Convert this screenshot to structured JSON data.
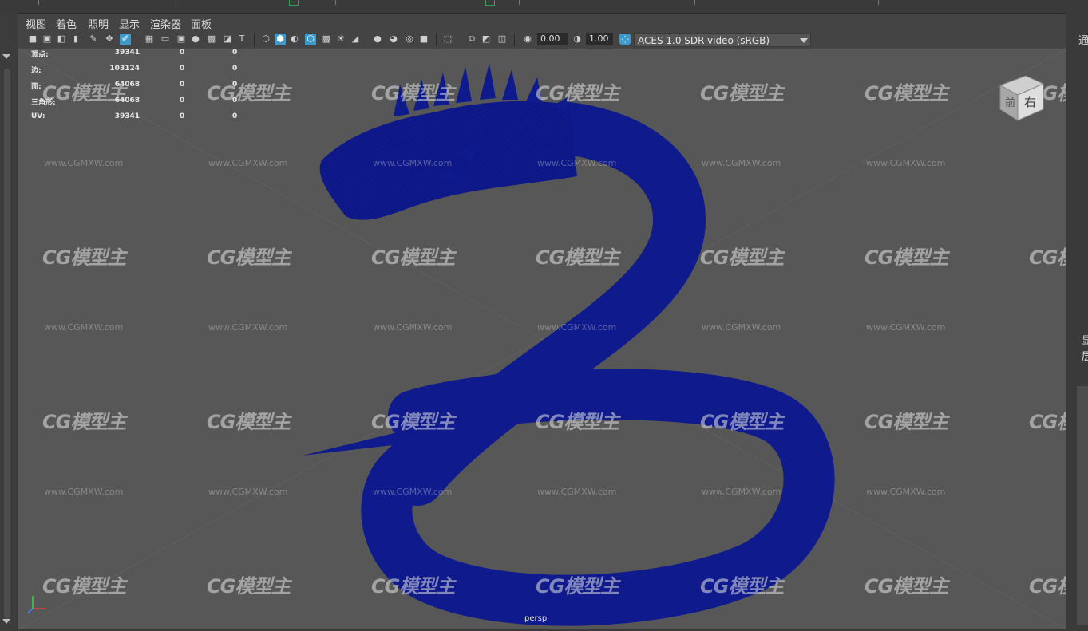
{
  "panel_menu": [
    "视图",
    "着色",
    "照明",
    "显示",
    "渲染器",
    "面板"
  ],
  "toolbar": {
    "exposure_value": "0.00",
    "gamma_value": "1.00",
    "colorspace": "ACES 1.0 SDR-video (sRGB)"
  },
  "hud": [
    {
      "label": "顶点:",
      "a": "39341",
      "b": "0",
      "c": "0"
    },
    {
      "label": "边:",
      "a": "103124",
      "b": "0",
      "c": "0"
    },
    {
      "label": "面:",
      "a": "64068",
      "b": "0",
      "c": "0"
    },
    {
      "label": "三角形:",
      "a": "64068",
      "b": "0",
      "c": "0"
    },
    {
      "label": "UV:",
      "a": "39341",
      "b": "0",
      "c": "0"
    }
  ],
  "viewport": {
    "camera_label": "persp",
    "viewcube_front": "前",
    "viewcube_right": "右"
  },
  "watermark": {
    "logo": "CG模型主",
    "url": "www.CGMXW.com"
  },
  "right_panel": {
    "top_char": "通",
    "char_a": "显",
    "char_b": "层"
  },
  "colors": {
    "wire": "#0f1a8c",
    "viewport_bg": "#575757",
    "ui_bg": "#444444",
    "accent": "#3c99c9"
  }
}
